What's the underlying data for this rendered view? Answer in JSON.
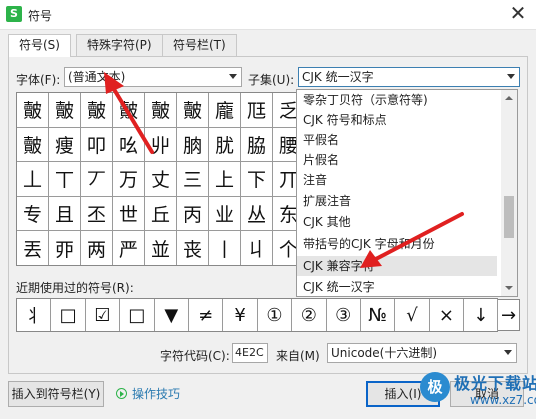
{
  "window": {
    "title": "符号",
    "app_icon_letter": "S",
    "close_glyph": "✕"
  },
  "tabs": [
    {
      "label": "符号(S)",
      "active": true
    },
    {
      "label": "特殊字符(P)",
      "active": false
    },
    {
      "label": "符号栏(T)",
      "active": false
    }
  ],
  "font": {
    "label": "字体(F):",
    "value": "(普通文本)"
  },
  "subset": {
    "label": "子集(U):",
    "value": "CJK 统一汉字"
  },
  "symbol_grid": [
    [
      "皾",
      "皾",
      "皾",
      "皾",
      "皾",
      "皾",
      "龐",
      "尫",
      "乏"
    ],
    [
      "皾",
      "痩",
      "叩",
      "吆",
      "丱",
      "朒",
      "肬",
      "脇",
      "腰"
    ],
    [
      "丄",
      "丅",
      "丆",
      "万",
      "丈",
      "三",
      "上",
      "下",
      "丌"
    ],
    [
      "专",
      "且",
      "丕",
      "世",
      "丘",
      "丙",
      "业",
      "丛",
      "东"
    ],
    [
      "丟",
      "丣",
      "两",
      "严",
      "並",
      "丧",
      "丨",
      "丩",
      "个"
    ]
  ],
  "subset_dropdown": {
    "items": [
      "零杂丁贝符（示意符等)",
      "CJK 符号和标点",
      "平假名",
      "片假名",
      "注音",
      "扩展注音",
      "CJK 其他",
      "带括号的CJK 字母和月份",
      "CJK 兼容字符",
      "CJK 统一汉字"
    ],
    "highlighted_index": 8
  },
  "recent": {
    "label": "近期使用过的符号(R):",
    "symbols": [
      "丬",
      "□",
      "☑",
      "□",
      "▼",
      "≠",
      "¥",
      "①",
      "②",
      "③",
      "№",
      "√",
      "×",
      "↓"
    ],
    "last_symbol": "→"
  },
  "char_code": {
    "label": "字符代码(C):",
    "value": "4E2C"
  },
  "from": {
    "label": "来自(M)",
    "value": "Unicode(十六进制)"
  },
  "buttons": {
    "insert_to_bar": "插入到符号栏(Y)",
    "tips": "操作技巧",
    "insert": "插入(I)",
    "cancel": "取消"
  },
  "watermark": {
    "logo": "极",
    "title": "极光下载站",
    "url": "www.xz7.com"
  },
  "colors": {
    "accent": "#0a64c8",
    "annotation_red": "#e02020"
  }
}
